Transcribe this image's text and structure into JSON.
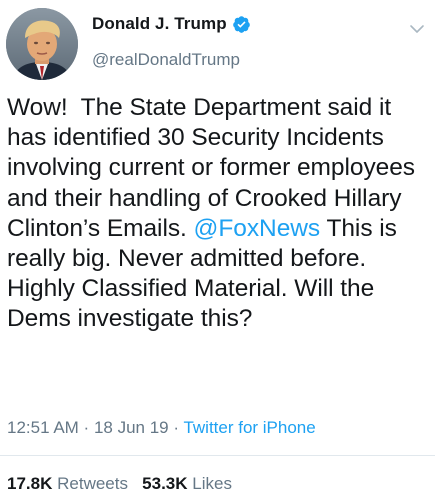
{
  "author": {
    "display_name": "Donald J. Trump",
    "handle": "@realDonaldTrump",
    "verified": true,
    "avatar_icon": "profile-photo"
  },
  "tweet": {
    "text_before": "Wow!  The State Department said it has identified 30 Security Incidents involving current or former employees and their handling of Crooked Hillary Clinton’s Emails. ",
    "mention": "@FoxNews",
    "text_after": " This is really big. Never admitted before. Highly Classified Material. Will the Dems investigate this?"
  },
  "meta": {
    "time": "12:51 AM",
    "date": "18 Jun 19",
    "separator": " · ",
    "source": "Twitter for iPhone"
  },
  "stats": {
    "retweets_count": "17.8K",
    "retweets_label": "Retweets",
    "likes_count": "53.3K",
    "likes_label": "Likes"
  },
  "colors": {
    "link": "#1da1f2",
    "secondary_text": "#657786",
    "primary_text": "#14171a",
    "divider": "#e1e8ed"
  }
}
